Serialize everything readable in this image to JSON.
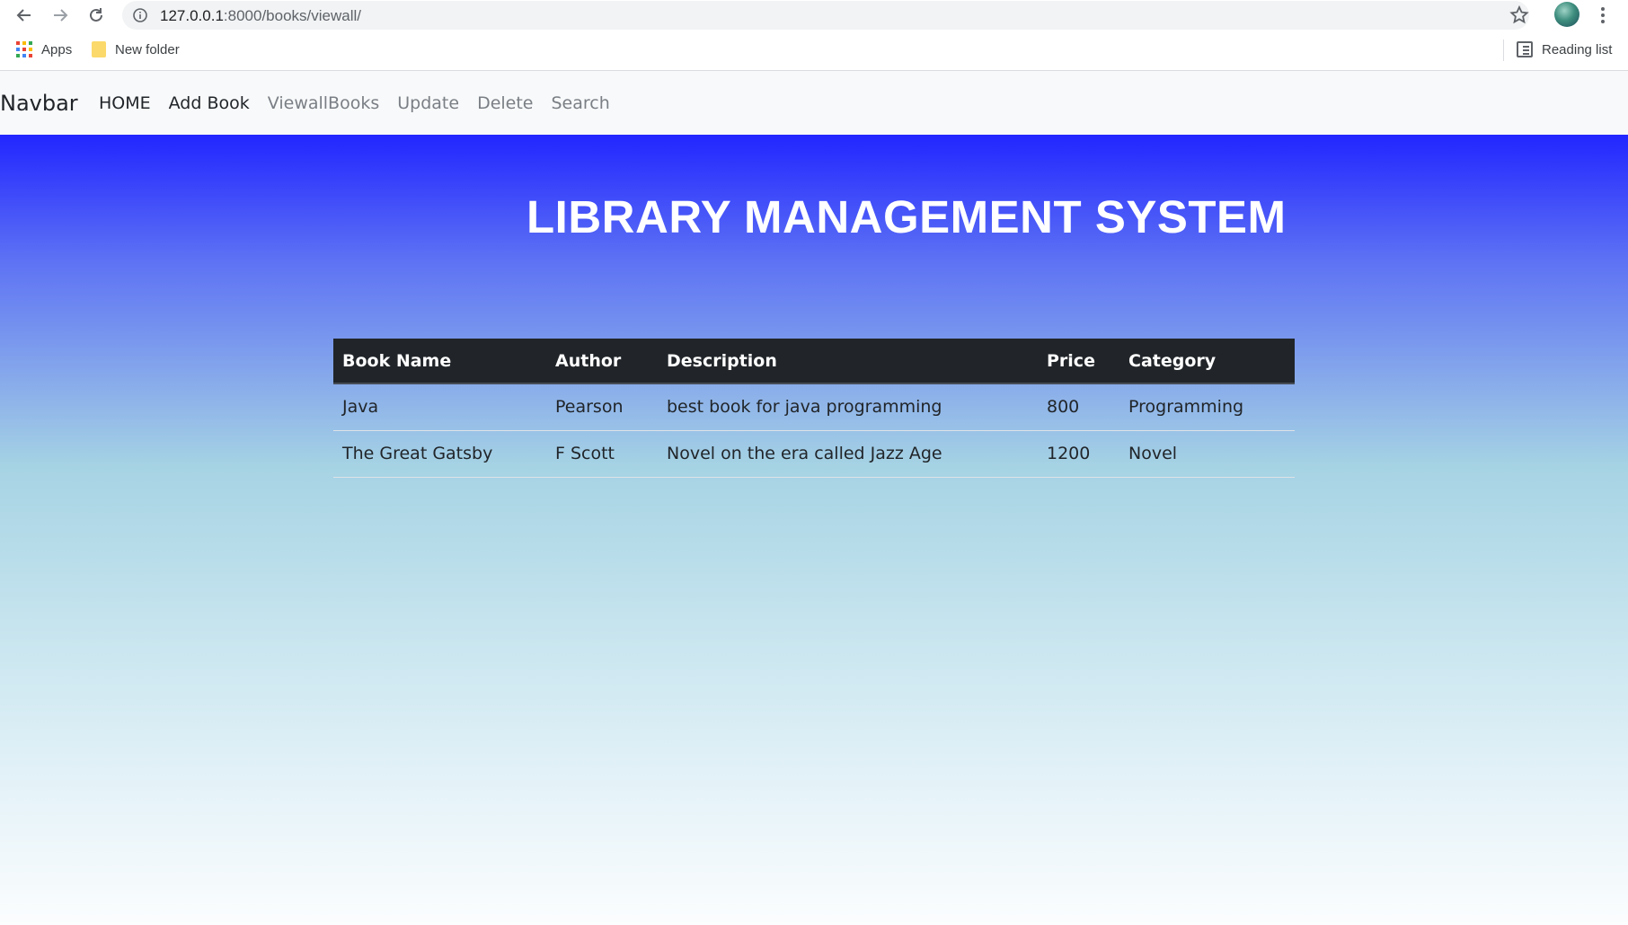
{
  "browser": {
    "url_host": "127.0.0.1",
    "url_rest": ":8000/books/viewall/",
    "bookmarks": [
      {
        "label": "Apps",
        "icon": "apps-grid-icon"
      },
      {
        "label": "New folder",
        "icon": "folder-icon"
      }
    ],
    "reading_list_label": "Reading list"
  },
  "navbar": {
    "brand": "Navbar",
    "links": [
      {
        "label": "HOME",
        "state": "active"
      },
      {
        "label": "Add Book",
        "state": "active"
      },
      {
        "label": "ViewallBooks",
        "state": "muted"
      },
      {
        "label": "Update",
        "state": "muted"
      },
      {
        "label": "Delete",
        "state": "muted"
      },
      {
        "label": "Search",
        "state": "muted"
      }
    ]
  },
  "main": {
    "title": "LIBRARY MANAGEMENT SYSTEM",
    "table": {
      "headers": [
        "Book Name",
        "Author",
        "Description",
        "Price",
        "Category"
      ],
      "rows": [
        [
          "Java",
          "Pearson",
          "best book for java programming",
          "800",
          "Programming"
        ],
        [
          "The Great Gatsby",
          "F Scott",
          "Novel on the era called Jazz Age",
          "1200",
          "Novel"
        ]
      ]
    }
  },
  "colors": {
    "gradient_top": "#2226ff",
    "gradient_bottom": "#fbfdfe",
    "table_header_bg": "#212529",
    "navbar_bg": "#f8f9fa"
  }
}
